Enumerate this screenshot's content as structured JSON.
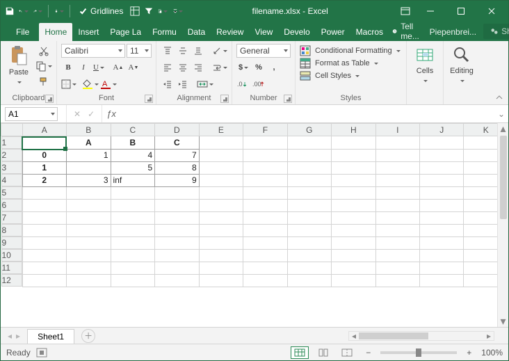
{
  "app": {
    "title": "filename.xlsx - Excel",
    "gridlines_label": "Gridlines",
    "gridlines_checked": true
  },
  "tabs": {
    "file": "File",
    "list": [
      "Home",
      "Insert",
      "Page La",
      "Formu",
      "Data",
      "Review",
      "View",
      "Develo",
      "Power",
      "Macros"
    ],
    "active": "Home",
    "tellme": "Tell me...",
    "username": "Piepenbrei...",
    "share": "Share"
  },
  "ribbon": {
    "clipboard": {
      "label": "Clipboard",
      "paste": "Paste"
    },
    "font": {
      "label": "Font",
      "name": "Calibri",
      "size": "11"
    },
    "alignment": {
      "label": "Alignment"
    },
    "number": {
      "label": "Number",
      "format": "General"
    },
    "styles": {
      "label": "Styles",
      "conditional": "Conditional Formatting",
      "table": "Format as Table",
      "cell": "Cell Styles"
    },
    "cells": {
      "label": "Cells",
      "btn": "Cells"
    },
    "editing": {
      "label": "Editing",
      "btn": "Editing"
    }
  },
  "formula_bar": {
    "namebox": "A1",
    "formula": ""
  },
  "grid": {
    "columns_shown": [
      "A",
      "B",
      "C",
      "D",
      "E",
      "F",
      "G",
      "H",
      "I",
      "J",
      "K"
    ],
    "rows_shown": 12,
    "headers": {
      "B1": "A",
      "C1": "B",
      "D1": "C"
    },
    "index": {
      "A2": "0",
      "A3": "1",
      "A4": "2"
    },
    "data": {
      "B2": "1",
      "C2": "4",
      "D2": "7",
      "C3": "5",
      "D3": "8",
      "B4": "3",
      "C4": "inf",
      "D4": "9"
    },
    "active_cell": "A1"
  },
  "chart_data": {
    "type": "table",
    "columns": [
      "A",
      "B",
      "C"
    ],
    "index": [
      0,
      1,
      2
    ],
    "values": [
      [
        1,
        4,
        7
      ],
      [
        null,
        5,
        8
      ],
      [
        3,
        "inf",
        9
      ]
    ]
  },
  "sheet_tabs": {
    "active": "Sheet1"
  },
  "status": {
    "ready": "Ready",
    "zoom": "100%"
  }
}
